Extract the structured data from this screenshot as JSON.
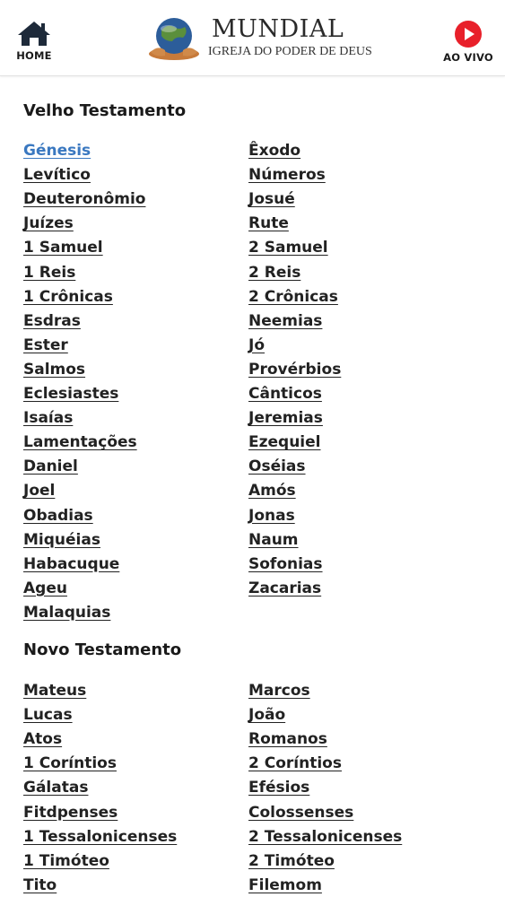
{
  "header": {
    "home_label": "HOME",
    "live_label": "AO VIVO",
    "brand_name": "MUNDIAL",
    "brand_sub": "IGREJA DO PODER DE DEUS",
    "live_color": "#e8202a"
  },
  "old_testament": {
    "title": "Velho Testamento",
    "books": [
      "Génesis",
      "Êxodo",
      "Levítico",
      "Números",
      "Deuteronômio",
      "Josué",
      "Juízes",
      "Rute",
      "1 Samuel",
      "2 Samuel",
      "1 Reis",
      "2 Reis",
      "1 Crônicas",
      "2 Crônicas",
      "Esdras",
      "Neemias",
      "Ester",
      "Jó",
      "Salmos",
      "Provérbios",
      "Eclesiastes",
      "Cânticos",
      "Isaías",
      "Jeremias",
      "Lamentações",
      "Ezequiel",
      "Daniel",
      "Oséias",
      "Joel",
      "Amós",
      "Obadias",
      "Jonas",
      "Miquéias",
      "Naum",
      "Habacuque",
      "Sofonias",
      "Ageu",
      "Zacarias",
      "Malaquias"
    ],
    "active_book": "Génesis"
  },
  "new_testament": {
    "title": "Novo Testamento",
    "books": [
      "Mateus",
      "Marcos",
      "Lucas",
      "João",
      "Atos",
      "Romanos",
      "1 Coríntios",
      "2 Coríntios",
      "Gálatas",
      "Efésios",
      "Fitdpenses",
      "Colossenses",
      "1 Tessalonicenses",
      "2 Tessalonicenses",
      "1 Timóteo",
      "2 Timóteo",
      "Tito",
      "Filemom"
    ]
  },
  "colors": {
    "link": "#222222",
    "active_link": "#3a78c0"
  }
}
